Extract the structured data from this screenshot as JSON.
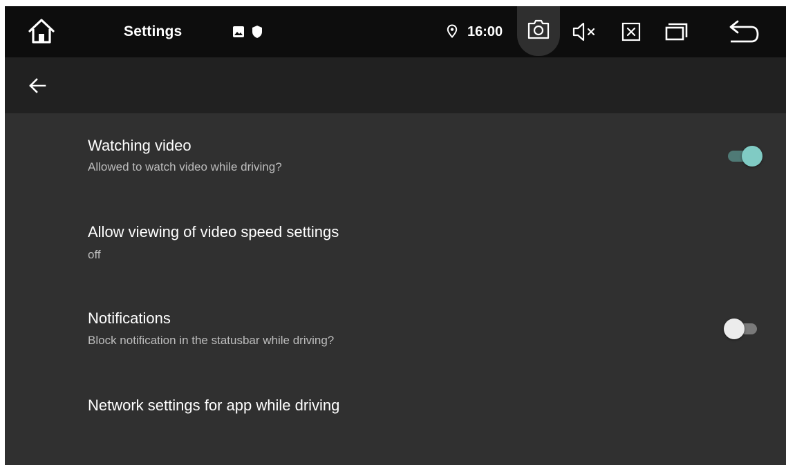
{
  "status_bar": {
    "app_title": "Settings",
    "clock": "16:00",
    "icons": [
      "home-icon",
      "image-notification-icon",
      "shield-notification-icon",
      "location-icon",
      "camera-icon",
      "volume-mute-icon",
      "close-box-icon",
      "recents-icon",
      "back-arrow-icon"
    ]
  },
  "action_bar": {
    "up_icon": "arrow-left-icon"
  },
  "settings": {
    "items": [
      {
        "title": "Watching video",
        "summary": "Allowed to watch video while driving?",
        "switch_on": true
      },
      {
        "title": "Allow viewing of video speed settings",
        "summary": "off"
      },
      {
        "title": "Notifications",
        "summary": "Block notification in the statusbar while driving?",
        "switch_on": false
      },
      {
        "title": "Network settings for app while driving"
      }
    ]
  },
  "colors": {
    "background": "#303030",
    "status_bar": "#0d0d0d",
    "action_bar": "#212121",
    "accent": "#80cbc4",
    "accent_track": "#4f7a76",
    "switch_off_thumb": "#ececec",
    "switch_off_track": "#7a7a7a"
  }
}
